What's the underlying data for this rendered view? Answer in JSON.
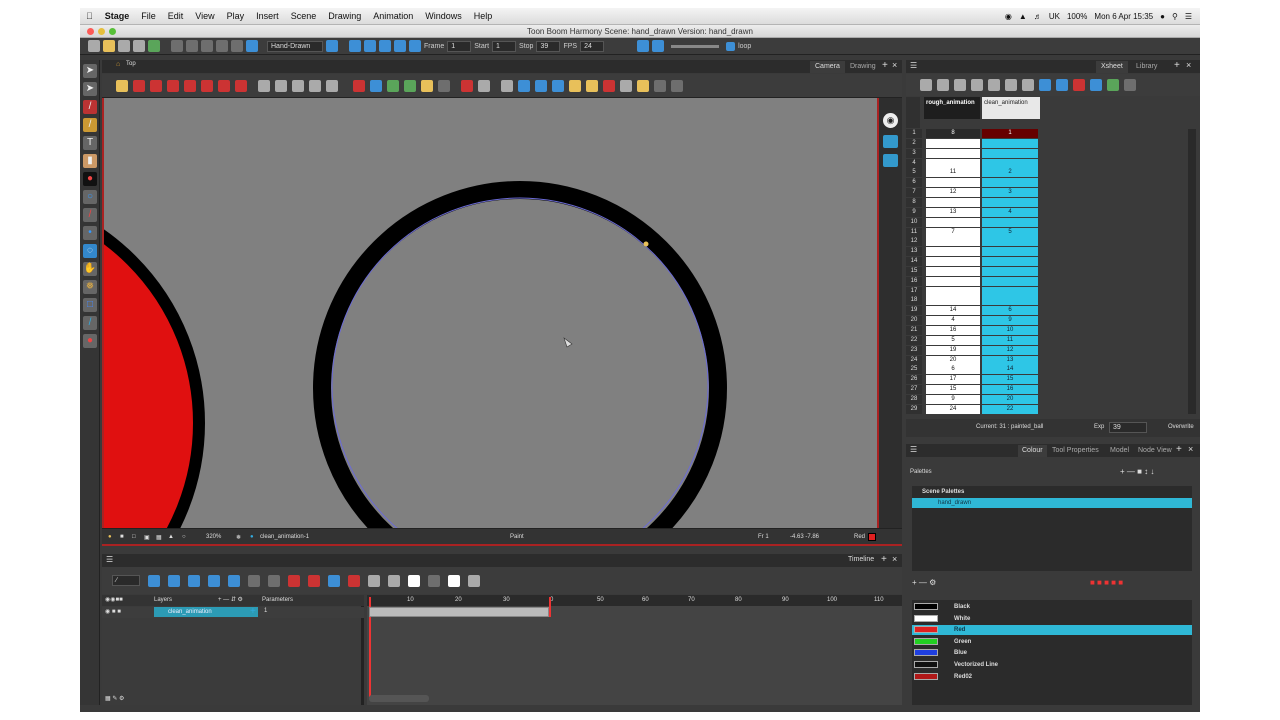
{
  "menubar": {
    "app": "Stage",
    "items": [
      "File",
      "Edit",
      "View",
      "Play",
      "Insert",
      "Scene",
      "Drawing",
      "Animation",
      "Windows",
      "Help"
    ],
    "flag": "UK",
    "battery": "100%",
    "clock": "Mon 6 Apr  15:35"
  },
  "window": {
    "title": "Toon Boom Harmony Scene: hand_drawn Version: hand_drawn"
  },
  "toptoolbar": {
    "workspace": "Hand-Drawn",
    "frame_label": "Frame",
    "frame_value": "1",
    "start_label": "Start",
    "start_value": "1",
    "stop_label": "Stop",
    "stop_value": "39",
    "fps_label": "FPS",
    "fps_value": "24",
    "loop_label": "loop"
  },
  "views": {
    "camera_tab": "Camera",
    "drawing_tab": "Drawing",
    "top_label": "Top"
  },
  "camera_status": {
    "zoom": "320%",
    "drawing": "clean_animation-1",
    "mode": "Paint",
    "frame": "Fr 1",
    "coords": "-4.63 -7.86",
    "color": "Red",
    "color_hex": "#e02020"
  },
  "timeline": {
    "title": "Timeline",
    "layers_label": "Layers",
    "params_label": "Parameters",
    "layer_name": "clean_animation",
    "layer_value": "1",
    "ruler": [
      "10",
      "20",
      "30",
      "0",
      "50",
      "60",
      "70",
      "80",
      "90",
      "100",
      "110"
    ]
  },
  "xsheet": {
    "tab": "Xsheet",
    "library_tab": "Library",
    "columns": [
      "rough_animation",
      "clean_animation"
    ],
    "rows": [
      "1",
      "2",
      "3",
      "4",
      "5",
      "6",
      "7",
      "8",
      "9",
      "10",
      "11",
      "12",
      "13",
      "14",
      "15",
      "16",
      "17",
      "18",
      "19",
      "20",
      "21",
      "22",
      "23",
      "24",
      "25",
      "26",
      "27",
      "28",
      "29"
    ],
    "rough": [
      "8",
      "",
      "",
      "",
      "11",
      "",
      "12",
      "",
      "13",
      "",
      "7",
      "",
      "",
      "",
      "",
      "",
      "",
      "",
      "14",
      "4",
      "16",
      "5",
      "19",
      "20",
      "6",
      "17",
      "15",
      "9",
      "24"
    ],
    "clean": [
      "1",
      "",
      "",
      "",
      "2",
      "",
      "3",
      "",
      "4",
      "",
      "5",
      "",
      "",
      "",
      "",
      "",
      "",
      "",
      "6",
      "9",
      "10",
      "11",
      "12",
      "13",
      "14",
      "15",
      "16",
      "20",
      "22"
    ],
    "current": "Current: 31 : painted_ball",
    "exp_label": "Exp",
    "exp_value": "39",
    "overwrite": "Overwrite"
  },
  "colour": {
    "tabs": [
      "Colour",
      "Tool Properties",
      "Model",
      "Node View"
    ],
    "palettes_label": "Palettes",
    "scene_palettes": "Scene Palettes",
    "palette_name": "hand_drawn",
    "swatches": [
      {
        "name": "Black",
        "hex": "#000000"
      },
      {
        "name": "White",
        "hex": "#ffffff"
      },
      {
        "name": "Red",
        "hex": "#e02020"
      },
      {
        "name": "Green",
        "hex": "#22d022"
      },
      {
        "name": "Blue",
        "hex": "#1f3fe0"
      },
      {
        "name": "Vectorized Line",
        "hex": "#111111"
      },
      {
        "name": "Red02",
        "hex": "#b01818"
      }
    ]
  }
}
